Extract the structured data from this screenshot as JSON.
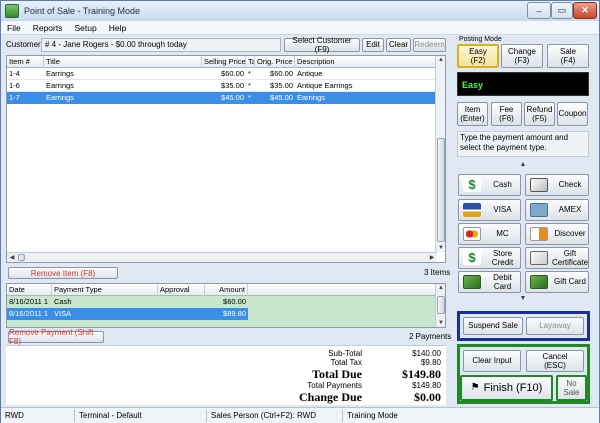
{
  "window": {
    "title": "Point of Sale - Training Mode",
    "min": "–",
    "max": "▭",
    "close": "✕"
  },
  "menu": [
    "File",
    "Reports",
    "Setup",
    "Help"
  ],
  "customer": {
    "label": "Customer",
    "value": "# 4 - Jane Rogers - $0.00 through today",
    "select": "Select Customer (F9)",
    "edit": "Edit",
    "clear": "Clear",
    "redeem": "Redeem"
  },
  "items": {
    "headers": [
      "Item #",
      "Title",
      "Selling Price",
      "Ta",
      "Orig. Price",
      "Description"
    ],
    "rows": [
      {
        "item": "1-4",
        "title": "Earrings",
        "price": "$60.00",
        "tax": "*",
        "orig": "$60.00",
        "desc": "Antique"
      },
      {
        "item": "1-6",
        "title": "Earrings",
        "price": "$35.00",
        "tax": "*",
        "orig": "$35.00",
        "desc": "Antique Earrings"
      },
      {
        "item": "1-7",
        "title": "Earrings",
        "price": "$45.00",
        "tax": "*",
        "orig": "$45.00",
        "desc": "Earrings"
      }
    ],
    "remove": "Remove Item (F8)",
    "count": "3 Items"
  },
  "payments": {
    "headers": [
      "Date",
      "Payment Type",
      "Approval",
      "Amount"
    ],
    "rows": [
      {
        "date": "8/16/2011 1",
        "type": "Cash",
        "approval": "",
        "amount": "$60.00"
      },
      {
        "date": "8/16/2011 1",
        "type": "VISA",
        "approval": "",
        "amount": "$89.80"
      }
    ],
    "remove": "Remove Payment (Shift F8)",
    "count": "2 Payments"
  },
  "totals": {
    "subtotal_label": "Sub-Total",
    "subtotal": "$140.00",
    "tax_label": "Total Tax",
    "tax": "$9.80",
    "due_label": "Total Due",
    "due": "$149.80",
    "payments_label": "Total Payments",
    "payments": "$149.80",
    "change_label": "Change Due",
    "change": "$0.00"
  },
  "posting": {
    "label": "Posting Mode",
    "easy1": "Easy",
    "easy2": "(F2)",
    "change1": "Change",
    "change2": "(F3)",
    "sale1": "Sale",
    "sale2": "(F4)",
    "display": "Easy"
  },
  "actions": {
    "item1": "Item",
    "item2": "(Enter)",
    "fee1": "Fee",
    "fee2": "(F6)",
    "refund1": "Refund",
    "refund2": "(F5)",
    "coupon": "Coupon"
  },
  "instruction": "Type the payment amount and select the payment type.",
  "pay_types": {
    "cash": "Cash",
    "check": "Check",
    "visa": "VISA",
    "amex": "AMEX",
    "mc": "MC",
    "discover": "Discover",
    "store1": "Store",
    "store2": "Credit",
    "gift1": "Gift",
    "gift2": "Certificate",
    "debit1": "Debit",
    "debit2": "Card",
    "giftcard": "Gift Card"
  },
  "suspend": "Suspend Sale",
  "layaway": "Layaway",
  "clear_input": "Clear Input",
  "cancel1": "Cancel",
  "cancel2": "(ESC)",
  "finish": "Finish (F10)",
  "nosale": "No Sale",
  "statusbar": {
    "user": "RWD",
    "terminal": "Terminal - Default",
    "salesperson": "Sales Person (Ctrl+F2): RWD",
    "mode": "Training Mode"
  }
}
